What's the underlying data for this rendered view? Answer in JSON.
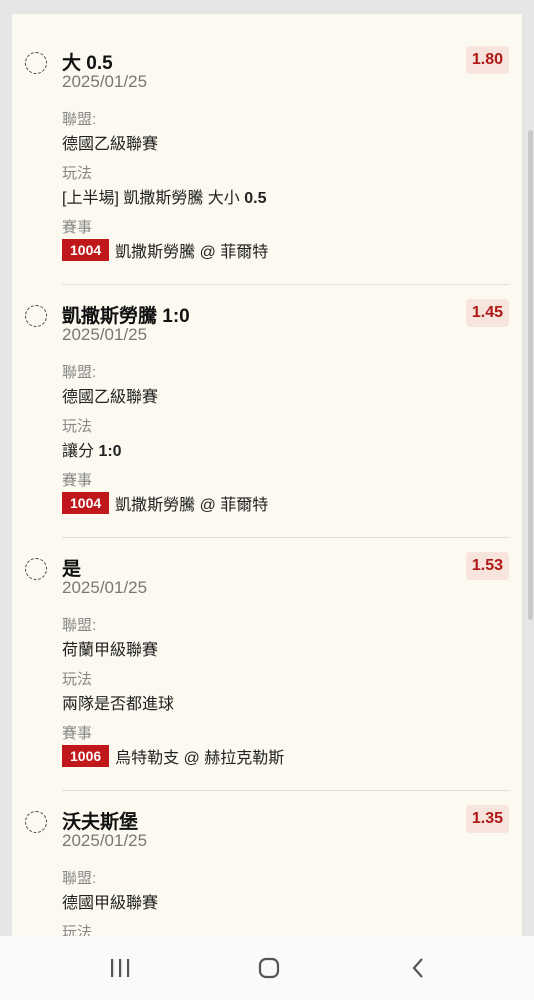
{
  "bets": [
    {
      "title": "大 0.5",
      "date": "2025/01/25",
      "odds": "1.80",
      "league_label": "聯盟:",
      "league": "德國乙級聯賽",
      "play_label": "玩法",
      "play_prefix": "[上半場] 凱撒斯勞騰 大小 ",
      "play_bold": "0.5",
      "event_label": "賽事",
      "event_code": "1004",
      "event": "凱撒斯勞騰 @ 菲爾特"
    },
    {
      "title": "凱撒斯勞騰 1:0",
      "date": "2025/01/25",
      "odds": "1.45",
      "league_label": "聯盟:",
      "league": "德國乙級聯賽",
      "play_label": "玩法",
      "play_prefix": "讓分 ",
      "play_bold": "1:0",
      "event_label": "賽事",
      "event_code": "1004",
      "event": "凱撒斯勞騰 @ 菲爾特"
    },
    {
      "title": "是",
      "date": "2025/01/25",
      "odds": "1.53",
      "league_label": "聯盟:",
      "league": "荷蘭甲級聯賽",
      "play_label": "玩法",
      "play_prefix": "兩隊是否都進球",
      "play_bold": "",
      "event_label": "賽事",
      "event_code": "1006",
      "event": "烏特勒支 @ 赫拉克勒斯"
    },
    {
      "title": "沃夫斯堡",
      "date": "2025/01/25",
      "odds": "1.35",
      "league_label": "聯盟:",
      "league": "德國甲級聯賽",
      "play_label": "玩法"
    }
  ],
  "navbar": {
    "recents_icon": "recents-icon",
    "home_icon": "home-icon",
    "back_icon": "back-icon"
  },
  "colors": {
    "accent": "#c0181a",
    "odds_bg": "#f7e4dc",
    "panel_bg": "#fcfaf0"
  }
}
